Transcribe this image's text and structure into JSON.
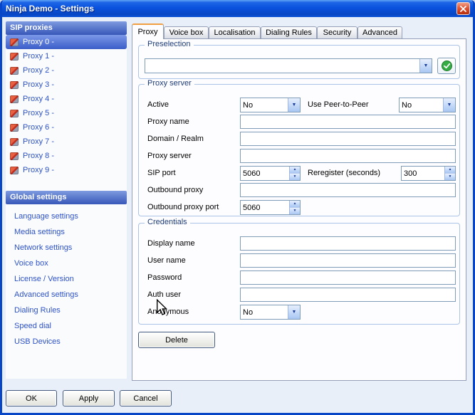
{
  "window": {
    "title": "Ninja Demo - Settings"
  },
  "icons": {
    "dropdown_arrow": "▼",
    "spin_up": "▲",
    "spin_down": "▼"
  },
  "sidebar": {
    "proxies_header": "SIP proxies",
    "proxies": [
      "Proxy 0 -",
      "Proxy 1 -",
      "Proxy 2 -",
      "Proxy 3 -",
      "Proxy 4 -",
      "Proxy 5 -",
      "Proxy 6 -",
      "Proxy 7 -",
      "Proxy 8 -",
      "Proxy 9 -"
    ],
    "global_header": "Global settings",
    "global_items": [
      "Language settings",
      "Media settings",
      "Network settings",
      "Voice box",
      "License / Version",
      "Advanced settings",
      "Dialing Rules",
      "Speed dial",
      "USB Devices"
    ]
  },
  "tabs": [
    "Proxy",
    "Voice box",
    "Localisation",
    "Dialing Rules",
    "Security",
    "Advanced"
  ],
  "preselection": {
    "legend": "Preselection",
    "value": ""
  },
  "proxy_server": {
    "legend": "Proxy server",
    "active": {
      "label": "Active",
      "value": "No"
    },
    "peer": {
      "label": "Use Peer-to-Peer",
      "value": "No"
    },
    "proxy_name": {
      "label": "Proxy name",
      "value": ""
    },
    "domain": {
      "label": "Domain / Realm",
      "value": ""
    },
    "server": {
      "label": "Proxy server",
      "value": ""
    },
    "sip_port": {
      "label": "SIP port",
      "value": "5060"
    },
    "reregister": {
      "label": "Reregister (seconds)",
      "value": "300"
    },
    "outbound": {
      "label": "Outbound proxy",
      "value": ""
    },
    "outbound_port": {
      "label": "Outbound proxy port",
      "value": "5060"
    }
  },
  "credentials": {
    "legend": "Credentials",
    "display_name": {
      "label": "Display name",
      "value": ""
    },
    "user_name": {
      "label": "User name",
      "value": ""
    },
    "password": {
      "label": "Password",
      "value": ""
    },
    "auth_user": {
      "label": "Auth user",
      "value": ""
    },
    "anonymous": {
      "label": "Anonymous",
      "value": "No"
    }
  },
  "buttons": {
    "delete": "Delete",
    "ok": "OK",
    "apply": "Apply",
    "cancel": "Cancel"
  }
}
